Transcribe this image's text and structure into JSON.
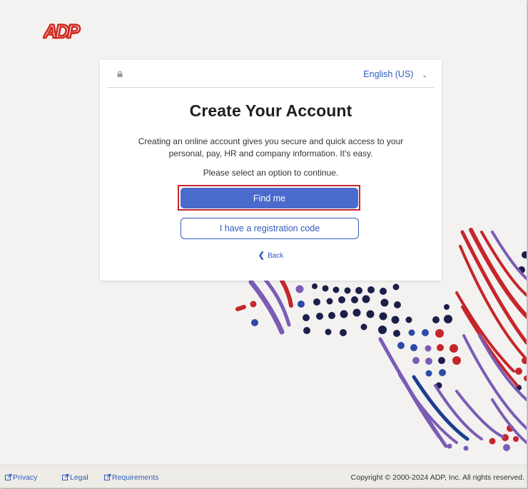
{
  "brand": {
    "logo_text": "ADP",
    "accent_color": "#d0271d"
  },
  "card": {
    "language": "English (US)",
    "title": "Create Your Account",
    "description": "Creating an online account gives you secure and quick access to your personal, pay, HR and company information. It's easy.",
    "prompt": "Please select an option to continue.",
    "primary_button": "Find me",
    "secondary_button": "I have a registration code",
    "back_label": "Back",
    "icons": {
      "lock": "lock-icon",
      "language_dropdown": "chevron-down-icon",
      "back": "chevron-left-icon"
    }
  },
  "colors": {
    "primary_button": "#4a6bcc",
    "link": "#2f5bbf",
    "highlight_border": "#c5262c",
    "background": "#f3f2f0"
  },
  "footer": {
    "links": [
      "Privacy",
      "Legal",
      "Requirements"
    ],
    "copyright": "Copyright © 2000-2024 ADP, Inc. All rights reserved."
  }
}
